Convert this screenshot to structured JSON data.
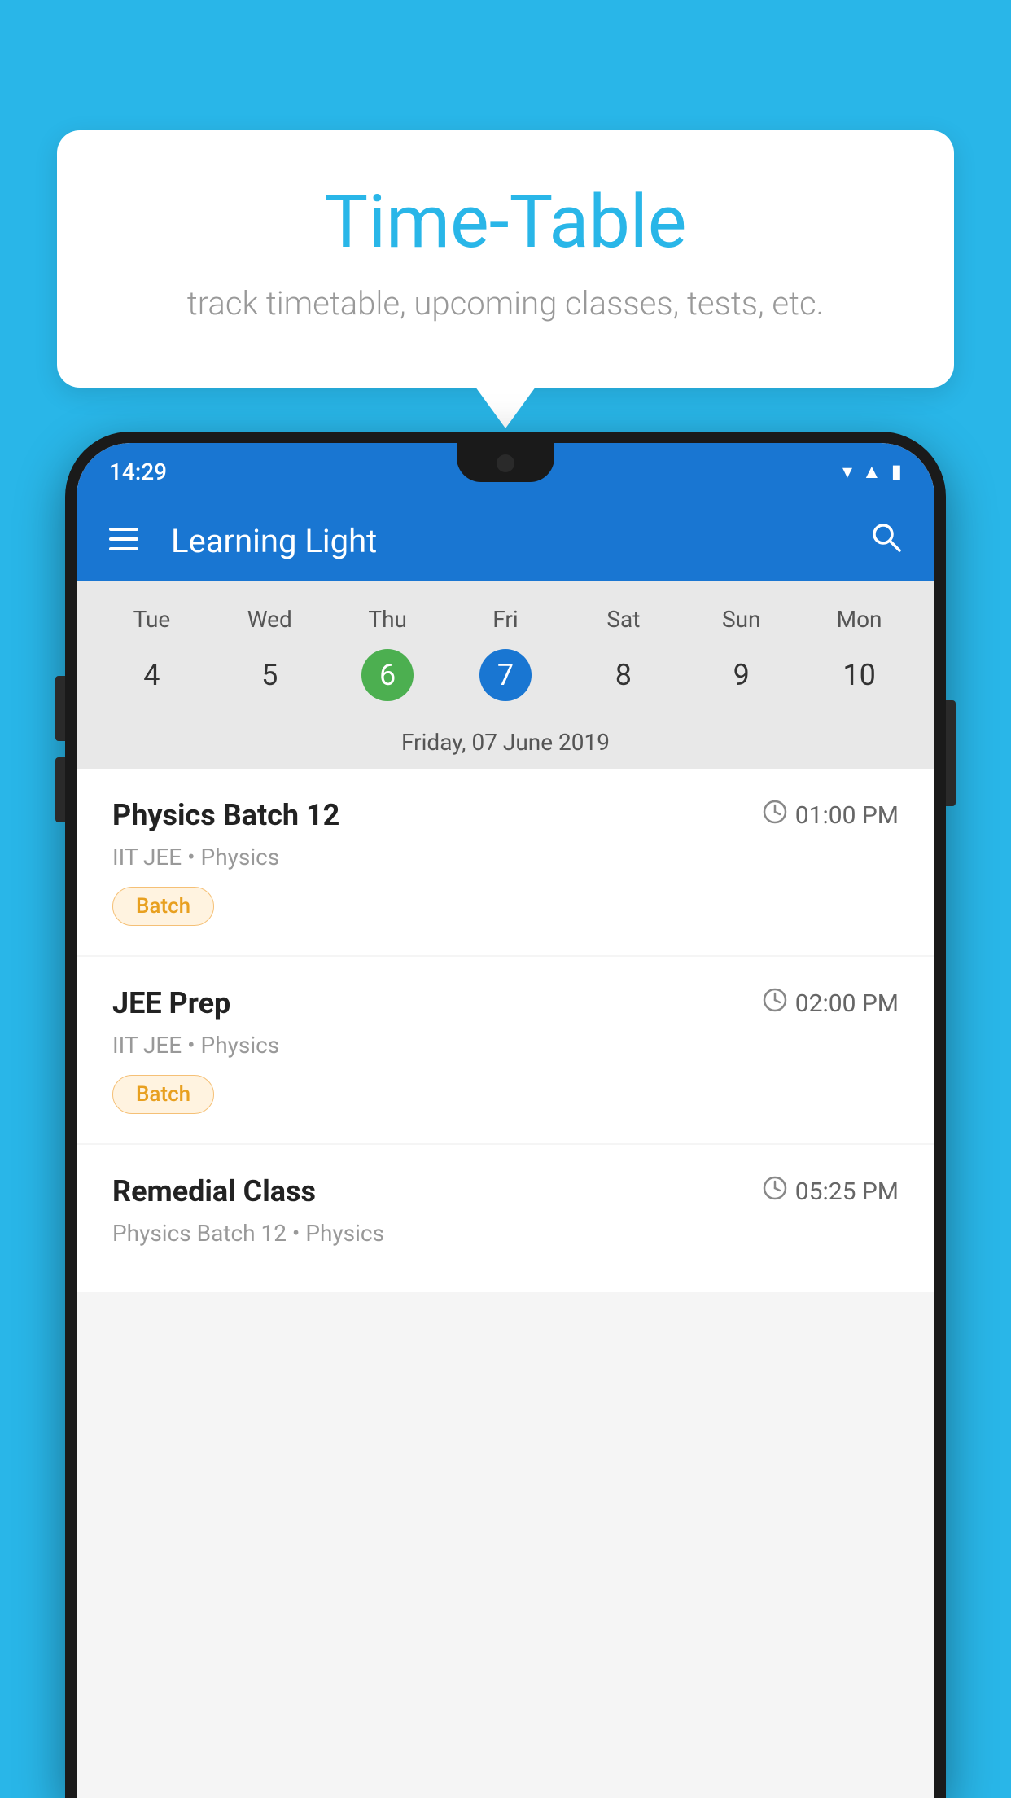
{
  "background_color": "#29B6E8",
  "tooltip": {
    "title": "Time-Table",
    "subtitle": "track timetable, upcoming classes, tests, etc."
  },
  "app": {
    "title": "Learning Light",
    "status_time": "14:29"
  },
  "calendar": {
    "days": [
      "Tue",
      "Wed",
      "Thu",
      "Fri",
      "Sat",
      "Sun",
      "Mon"
    ],
    "dates": [
      "4",
      "5",
      "6",
      "7",
      "8",
      "9",
      "10"
    ],
    "today_index": 2,
    "selected_index": 3,
    "selected_label": "Friday, 07 June 2019"
  },
  "classes": [
    {
      "name": "Physics Batch 12",
      "time": "01:00 PM",
      "info": "IIT JEE • Physics",
      "badge": "Batch"
    },
    {
      "name": "JEE Prep",
      "time": "02:00 PM",
      "info": "IIT JEE • Physics",
      "badge": "Batch"
    },
    {
      "name": "Remedial Class",
      "time": "05:25 PM",
      "info": "Physics Batch 12 • Physics",
      "badge": ""
    }
  ],
  "labels": {
    "menu_icon": "≡",
    "search_icon": "🔍",
    "clock_symbol": "🕐"
  }
}
